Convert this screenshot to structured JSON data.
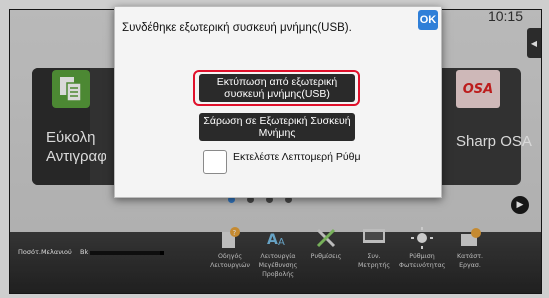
{
  "status_bar": {
    "time": "10:15"
  },
  "home": {
    "apps": [
      {
        "label_line1": "Εύκολη",
        "label_line2": "Αντιγραφή",
        "icon": "copy-icon"
      },
      {
        "label": "Sharp OSA",
        "icon_text": "OSA",
        "icon": "osa-icon"
      }
    ],
    "page_indicator": {
      "count": 4,
      "active": 1
    },
    "next_icon": "play-icon"
  },
  "bottom_bar": {
    "toner_label": "Ποσότ.Μελανιού",
    "toner_color_label": "Bk",
    "toner_level": 0.95,
    "items": [
      {
        "label": "Οδηγός Λειτουργιών",
        "icon": "guide-icon"
      },
      {
        "label": "Λειτουργία Μεγέθυνσης Προβολής",
        "icon": "zoom-icon"
      },
      {
        "label": "Ρυθμίσεις",
        "icon": "settings-icon"
      },
      {
        "label": "Συν. Μετρητής",
        "icon": "counter-icon"
      },
      {
        "label": "Ρύθμιση Φωτεινότητας",
        "icon": "brightness-icon"
      },
      {
        "label": "Κατάστ. Εργασ.",
        "icon": "job-status-icon"
      }
    ]
  },
  "dialog": {
    "message": "Συνδέθηκε εξωτερική συσκευή μνήμης(USB).",
    "ok_label": "OK",
    "options": [
      {
        "label": "Εκτύπωση από εξωτερική συσκευή μνήμης(USB)",
        "highlighted": true
      },
      {
        "label": "Σάρωση σε Εξωτερική Συσκευή Μνήμης"
      }
    ],
    "checkbox": {
      "label": "Εκτελέστε Λεπτομερή Ρύθμ",
      "checked": false
    }
  },
  "colors": {
    "accent": "#2f7fd8",
    "highlight": "#e0102b",
    "copy_icon": "#5aa03c",
    "osa_red": "#dd2222"
  }
}
